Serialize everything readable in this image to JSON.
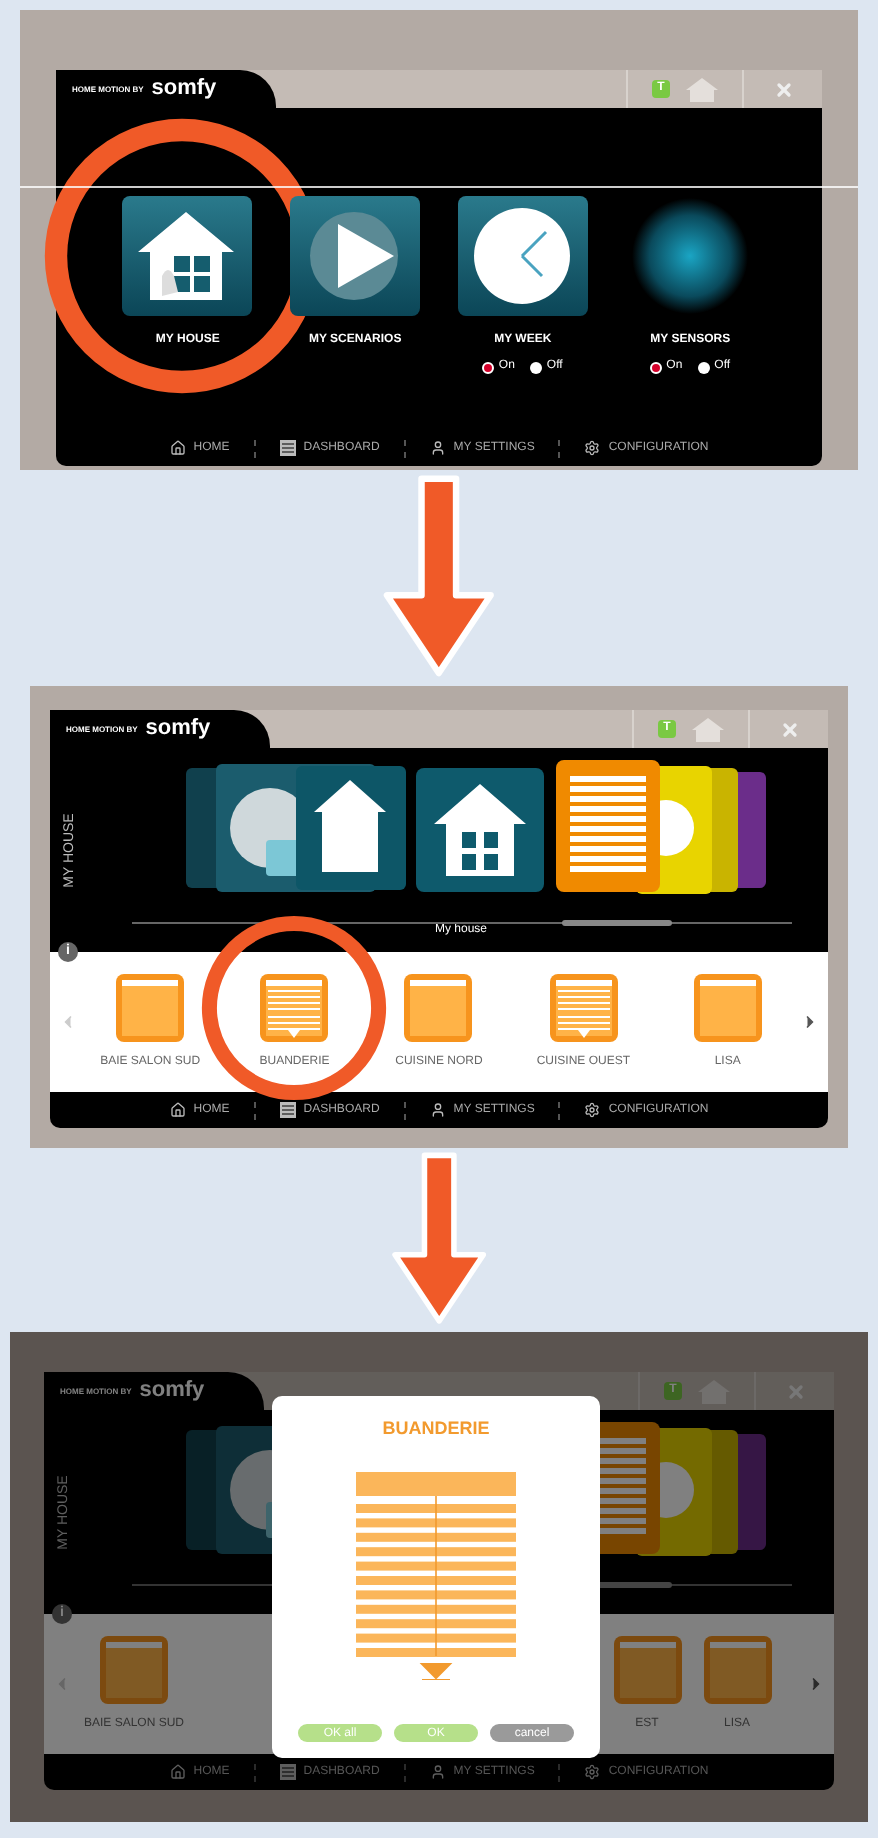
{
  "screens": [
    {
      "kind": "home",
      "dimmed": false,
      "brand": {
        "tagline": "HOME MOTION BY",
        "name": "somfy"
      },
      "badge": "T",
      "tiles": [
        {
          "kind": "house",
          "label": "MY HOUSE",
          "highlighted": true
        },
        {
          "kind": "scenarios",
          "label": "MY SCENARIOS",
          "highlighted": false
        },
        {
          "kind": "week",
          "label": "MY WEEK",
          "highlighted": false,
          "options": [
            {
              "label": "On",
              "selected": true
            },
            {
              "label": "Off",
              "selected": false
            }
          ]
        },
        {
          "kind": "sensors",
          "label": "MY SENSORS",
          "highlighted": false,
          "options": [
            {
              "label": "On",
              "selected": true
            },
            {
              "label": "Off",
              "selected": false
            }
          ]
        }
      ],
      "nav": [
        "HOME",
        "DASHBOARD",
        "MY SETTINGS",
        "CONFIGURATION"
      ]
    },
    {
      "kind": "house",
      "dimmed": false,
      "brand": {
        "tagline": "HOME MOTION BY",
        "name": "somfy"
      },
      "badge": "T",
      "side_label": "MY HOUSE",
      "caption": "My house",
      "info": "i",
      "devices": [
        {
          "label": "BAIE SALON SUD",
          "closed": false,
          "highlighted": false
        },
        {
          "label": "BUANDERIE",
          "closed": true,
          "highlighted": true
        },
        {
          "label": "CUISINE NORD",
          "closed": false,
          "highlighted": false
        },
        {
          "label": "CUISINE OUEST",
          "closed": true,
          "highlighted": false
        },
        {
          "label": "LISA",
          "closed": false,
          "highlighted": false
        }
      ],
      "nav": [
        "HOME",
        "DASHBOARD",
        "MY SETTINGS",
        "CONFIGURATION"
      ]
    },
    {
      "kind": "house",
      "dimmed": true,
      "brand": {
        "tagline": "HOME MOTION BY",
        "name": "somfy"
      },
      "badge": "T",
      "side_label": "MY HOUSE",
      "info": "i",
      "devices": [
        {
          "label": "BAIE SALON SUD",
          "closed": false,
          "highlighted": false
        },
        {
          "label": "EST",
          "closed": false,
          "highlighted": false
        },
        {
          "label": "LISA",
          "closed": false,
          "highlighted": false
        }
      ],
      "nav": [
        "HOME",
        "DASHBOARD",
        "MY SETTINGS",
        "CONFIGURATION"
      ],
      "dialog": {
        "title": "BUANDERIE",
        "buttons": [
          {
            "label": "OK all",
            "kind": "confirm"
          },
          {
            "label": "OK",
            "kind": "confirm"
          },
          {
            "label": "cancel",
            "kind": "cancel"
          }
        ]
      }
    }
  ]
}
